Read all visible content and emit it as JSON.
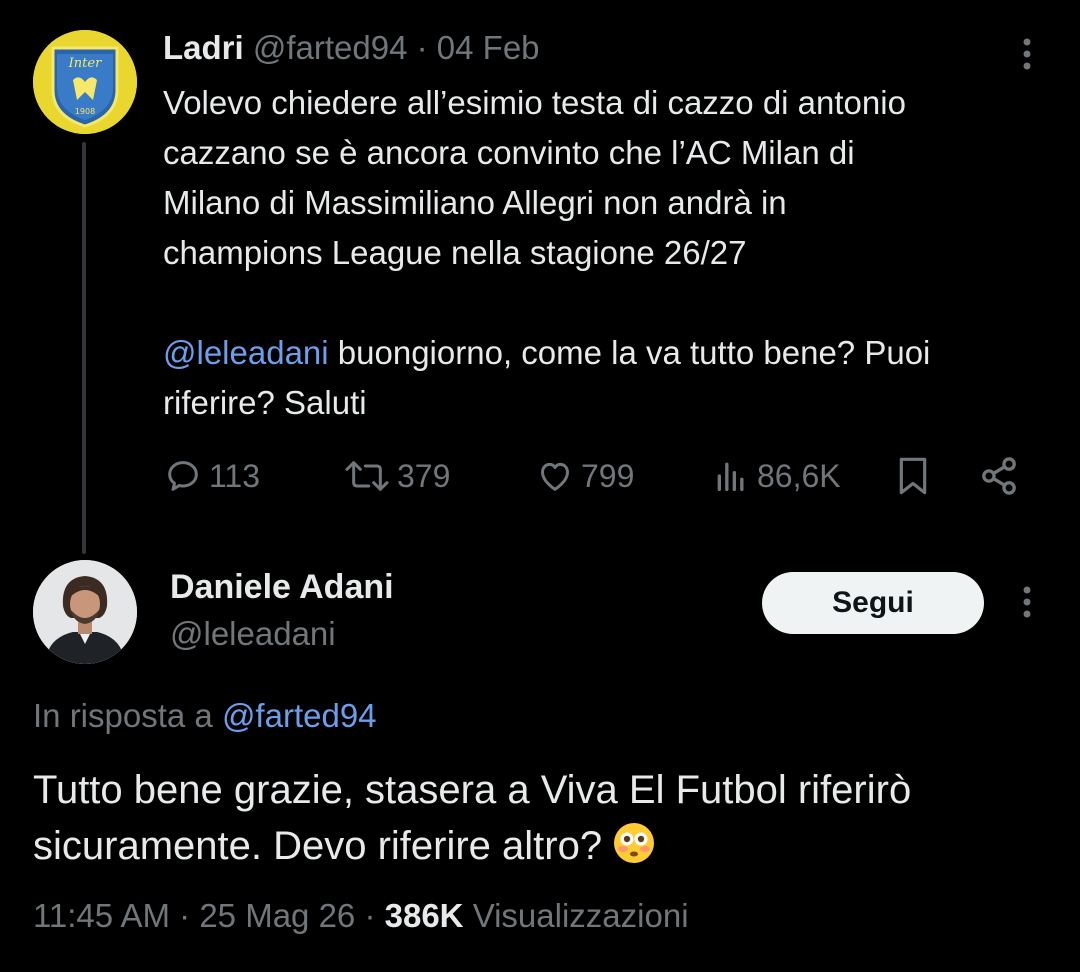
{
  "tweet1": {
    "avatar_icon": "inter-crest-logo",
    "avatar_text": "Inter",
    "avatar_year": "1908",
    "display_name": "Ladri",
    "handle": "@farted94",
    "separator": "·",
    "date": "04 Feb",
    "body_lines": [
      "Volevo chiedere all’esimio testa di cazzo di antonio",
      "cazzano se è ancora convinto che l’AC Milan di",
      "Milano di Massimiliano Allegri non andrà in",
      "champions League nella stagione 26/27"
    ],
    "mention": "@leleadani",
    "second_line_1": " buongiorno, come la va tutto bene? Puoi",
    "second_line_2": "riferire? Saluti",
    "actions": {
      "replies": "113",
      "reposts": "379",
      "likes": "799",
      "views": "86,6K"
    }
  },
  "tweet2": {
    "display_name": "Daniele Adani",
    "handle": "@leleadani",
    "follow_label": "Segui",
    "reply_prefix": "In risposta a ",
    "reply_handle": "@farted94",
    "body_line_1": "Tutto bene grazie, stasera a Viva El Futbol riferirò",
    "body_line_2": "sicuramente. Devo riferire altro?",
    "emoji": "flushed-face-emoji",
    "time": "11:45 AM",
    "separator": "·",
    "date": "25 Mag 26",
    "views_count": "386K",
    "views_label": "Visualizzazioni"
  },
  "colors": {
    "background": "#000000",
    "text_primary": "#e7e9ea",
    "text_secondary": "#71767b",
    "link": "#6d9eeb",
    "follow_bg": "#eff3f4"
  }
}
